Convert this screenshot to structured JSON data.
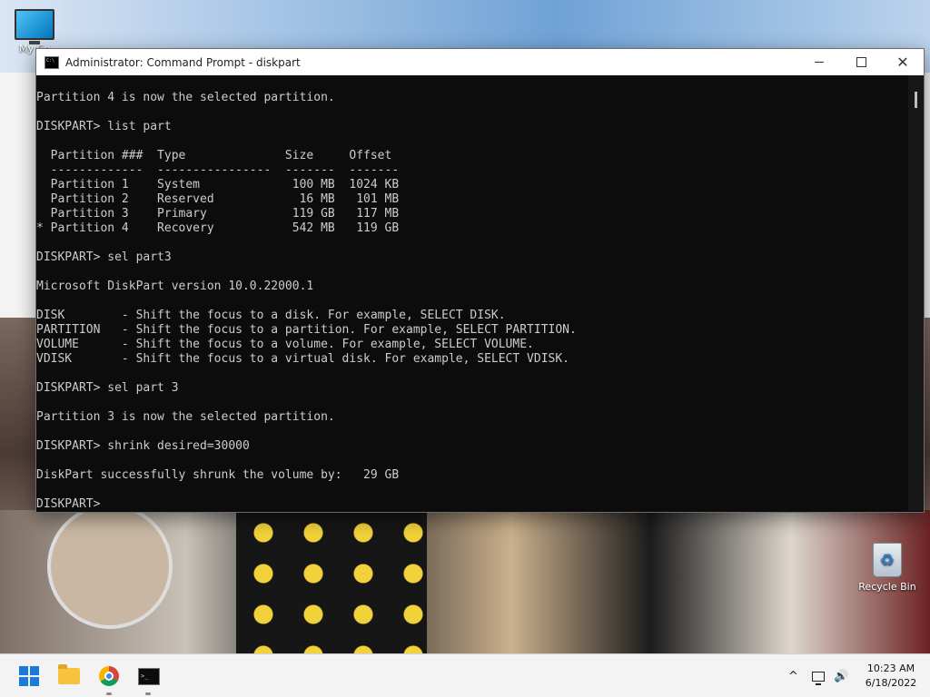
{
  "desktop": {
    "icons": [
      {
        "label": "My Co"
      },
      {
        "label": "Recycle Bin"
      }
    ]
  },
  "window": {
    "title": "Administrator: Command Prompt - diskpart",
    "controls": {
      "minimize": "",
      "maximize": "",
      "close": "✕"
    }
  },
  "console": {
    "text": "Partition 4 is now the selected partition.\n\nDISKPART> list part\n\n  Partition ###  Type              Size     Offset\n  -------------  ----------------  -------  -------\n  Partition 1    System             100 MB  1024 KB\n  Partition 2    Reserved            16 MB   101 MB\n  Partition 3    Primary            119 GB   117 MB\n* Partition 4    Recovery           542 MB   119 GB\n\nDISKPART> sel part3\n\nMicrosoft DiskPart version 10.0.22000.1\n\nDISK        - Shift the focus to a disk. For example, SELECT DISK.\nPARTITION   - Shift the focus to a partition. For example, SELECT PARTITION.\nVOLUME      - Shift the focus to a volume. For example, SELECT VOLUME.\nVDISK       - Shift the focus to a virtual disk. For example, SELECT VDISK.\n\nDISKPART> sel part 3\n\nPartition 3 is now the selected partition.\n\nDISKPART> shrink desired=30000\n\nDiskPart successfully shrunk the volume by:   29 GB\n\nDISKPART>"
  },
  "taskbar": {
    "tray": {
      "chevron": "^",
      "volume": "🔊"
    },
    "clock": {
      "time": "10:23 AM",
      "date": "6/18/2022"
    }
  }
}
